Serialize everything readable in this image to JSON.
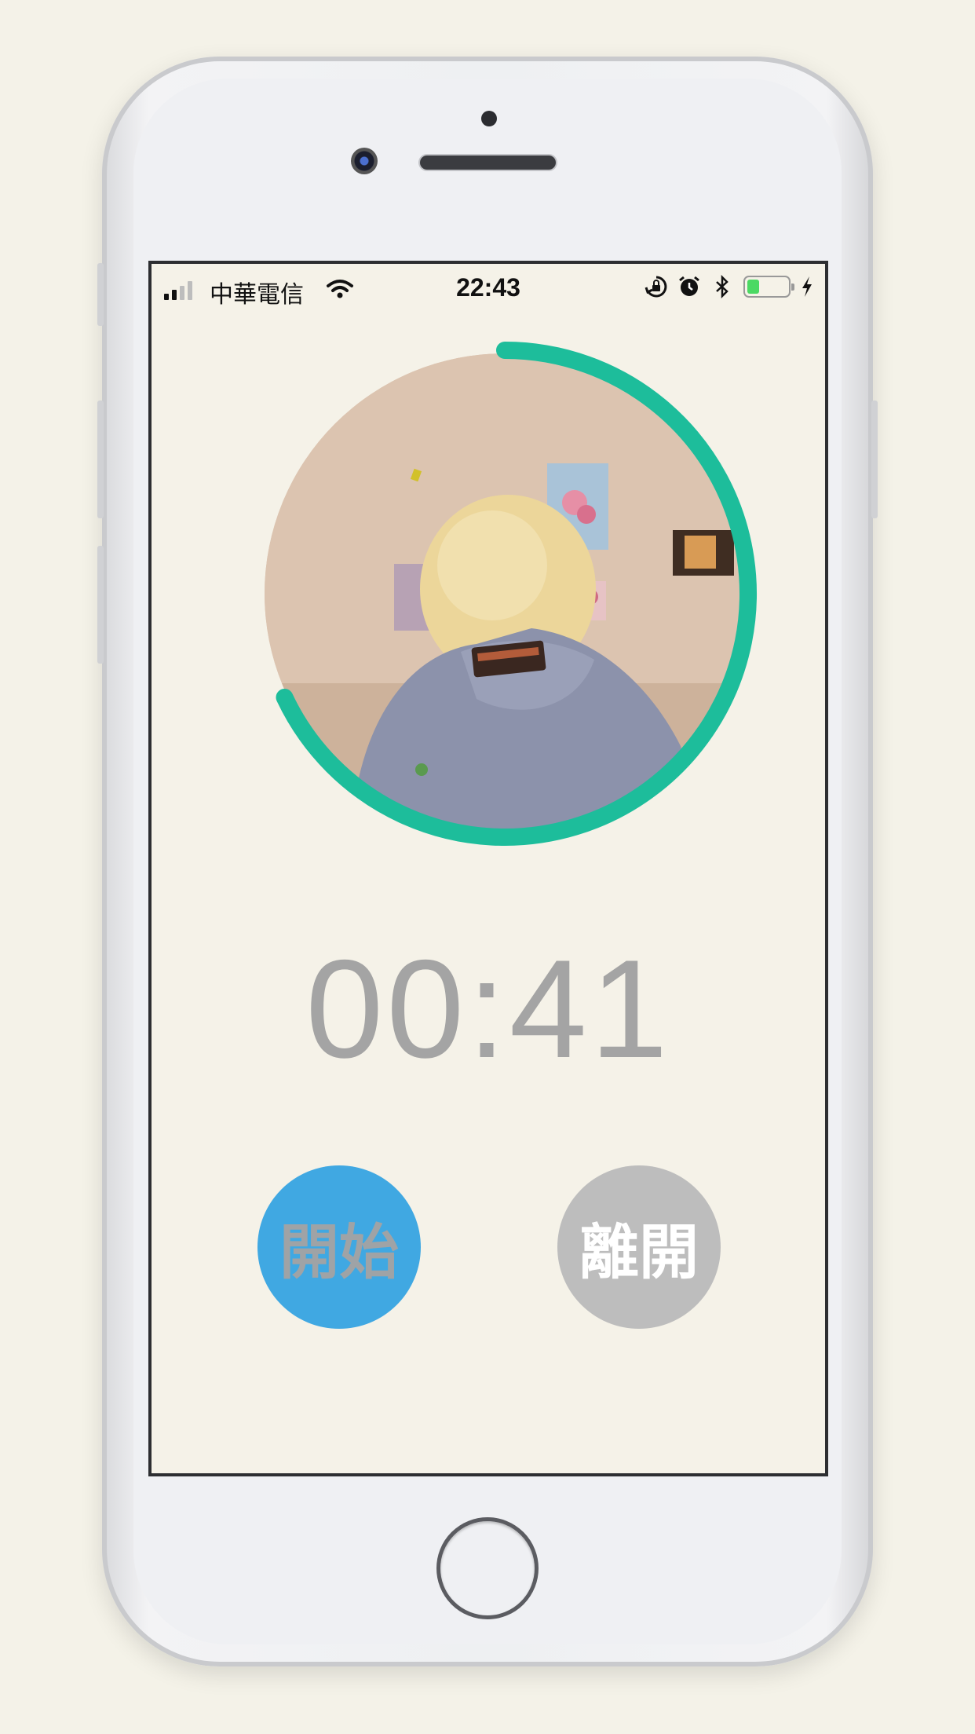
{
  "status_bar": {
    "carrier": "中華電信",
    "time": "22:43",
    "battery_level": 0.3,
    "icons": [
      "signal-icon",
      "wifi-icon",
      "rotation-lock-icon",
      "alarm-icon",
      "bluetooth-icon",
      "battery-icon",
      "charging-icon"
    ]
  },
  "timer": {
    "display": "00:41",
    "progress_fraction": 0.68
  },
  "buttons": {
    "start_label": "開始",
    "leave_label": "離開"
  },
  "colors": {
    "background": "#f5f2e8",
    "progress_ring": "#1dbd9b",
    "start_button": "#40a8e2",
    "leave_button": "#bdbdbd",
    "timer_text": "#a4a4a4"
  }
}
